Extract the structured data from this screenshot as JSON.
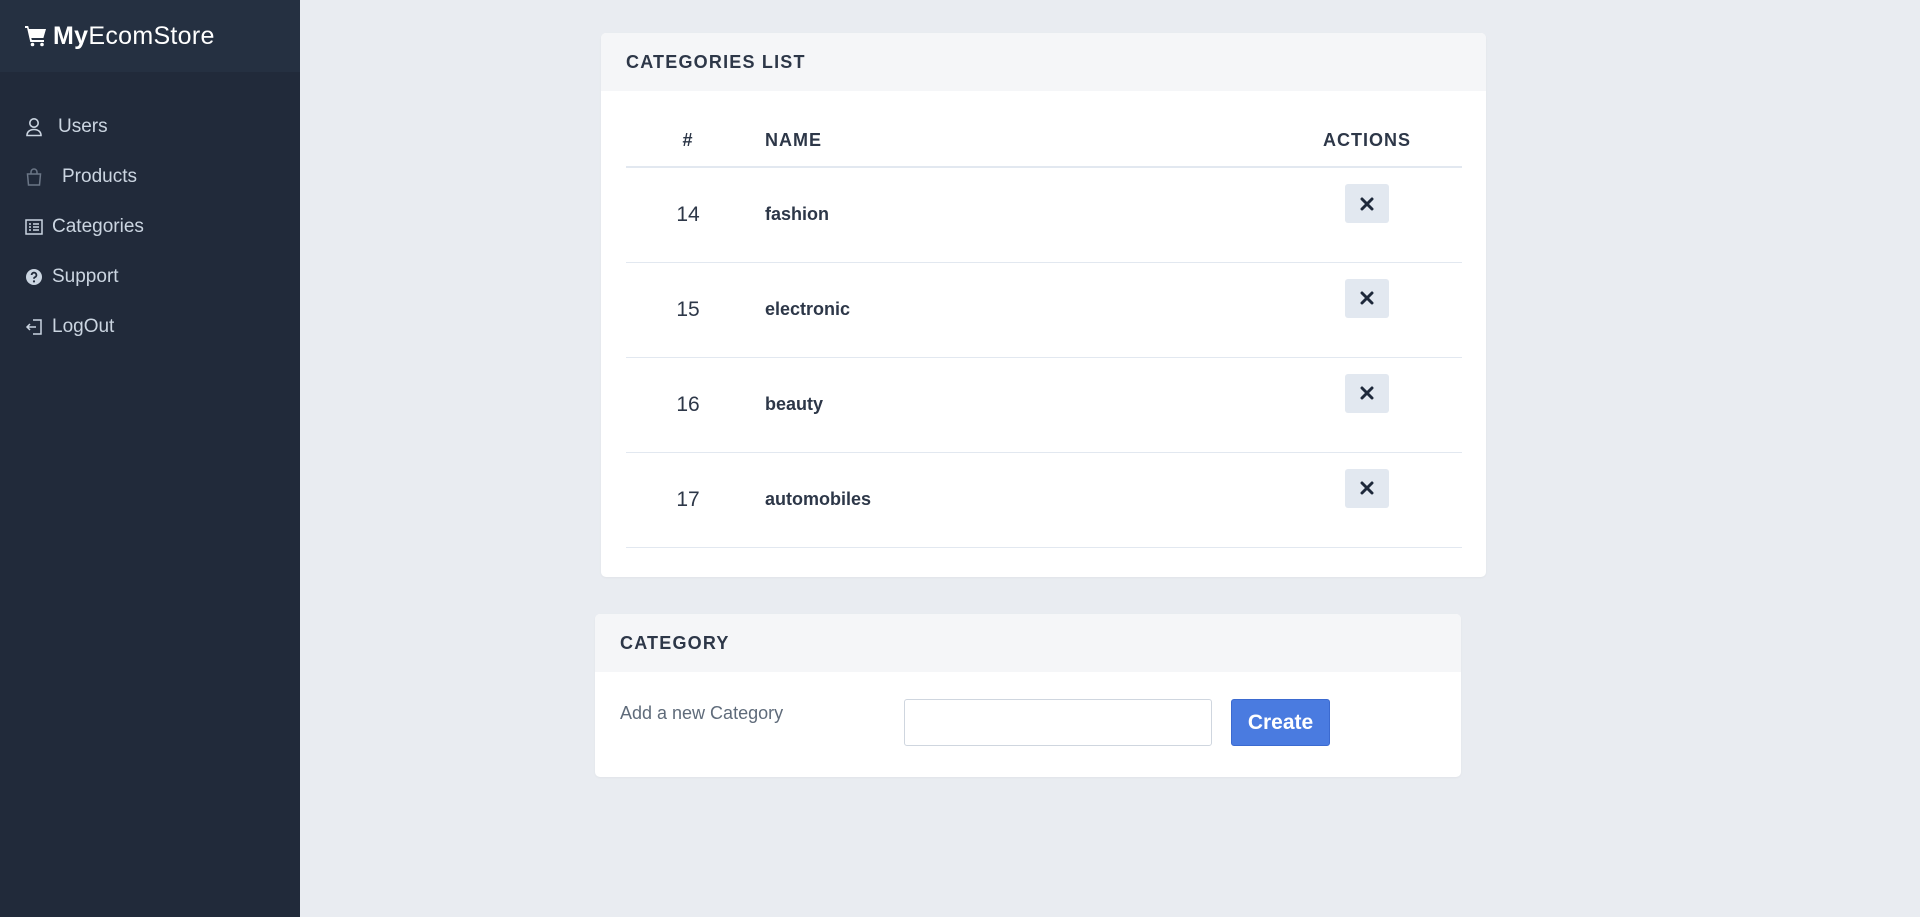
{
  "brand": {
    "bold": "My",
    "rest": "EcomStore"
  },
  "sidebar": {
    "items": [
      {
        "label": "Users",
        "icon": "user-icon"
      },
      {
        "label": "Products",
        "icon": "shopping-bag-icon"
      },
      {
        "label": "Categories",
        "icon": "list-icon"
      },
      {
        "label": "Support",
        "icon": "question-circle-icon"
      },
      {
        "label": "LogOut",
        "icon": "logout-icon"
      }
    ]
  },
  "categories_list": {
    "title": "CATEGORIES LIST",
    "columns": [
      "#",
      "NAME",
      "ACTIONS"
    ],
    "rows": [
      {
        "id": "14",
        "name": "fashion"
      },
      {
        "id": "15",
        "name": "electronic"
      },
      {
        "id": "16",
        "name": "beauty"
      },
      {
        "id": "17",
        "name": "automobiles"
      }
    ],
    "delete_icon": "close-icon"
  },
  "category_form": {
    "title": "CATEGORY",
    "label": "Add a new Category",
    "input_value": "",
    "input_placeholder": "",
    "button_label": "Create"
  },
  "colors": {
    "sidebar_bg": "#212a3a",
    "brand_bg": "#253041",
    "page_bg": "#e9ecf1",
    "accent": "#4a7be0"
  }
}
